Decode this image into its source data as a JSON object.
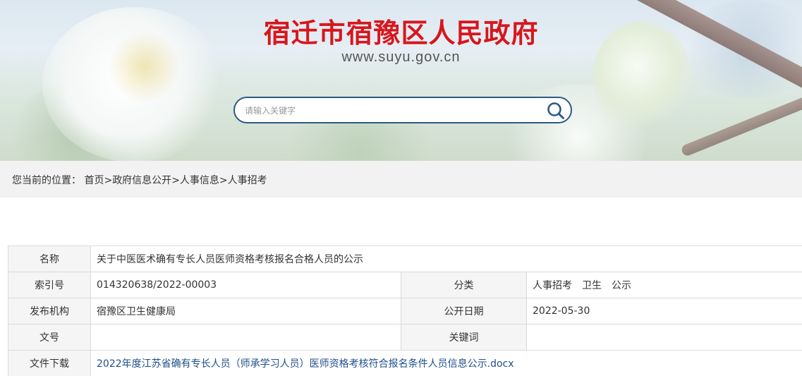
{
  "header": {
    "site_title": "宿迁市宿豫区人民政府",
    "site_url": "www.suyu.gov.cn"
  },
  "search": {
    "placeholder": "请输入关键字",
    "value": "",
    "icon": "search-icon",
    "accent_color": "#2d5a85"
  },
  "breadcrumb": {
    "prefix": "您当前的位置：",
    "items": [
      "首页",
      "政府信息公开",
      "人事信息",
      "人事招考"
    ],
    "separator": ">"
  },
  "info": {
    "name_label": "名称",
    "name_value": "关于中医医术确有专长人员医师资格考核报名合格人员的公示",
    "index_label": "索引号",
    "index_value": "014320638/2022-00003",
    "category_label": "分类",
    "category_value": "人事招考　卫生　公示",
    "publisher_label": "发布机构",
    "publisher_value": "宿豫区卫生健康局",
    "date_label": "公开日期",
    "date_value": "2022-05-30",
    "docno_label": "文号",
    "docno_value": "",
    "keywords_label": "关键词",
    "keywords_value": "",
    "download_label": "文件下载",
    "download_value": "2022年度江苏省确有专长人员（师承学习人员）医师资格考核符合报名条件人员信息公示.docx"
  },
  "colors": {
    "title_red": "#d7161d",
    "link_blue": "#1f4e8a",
    "label_bg": "#f5f5f5",
    "breadcrumb_bg": "#f2f2f2"
  }
}
